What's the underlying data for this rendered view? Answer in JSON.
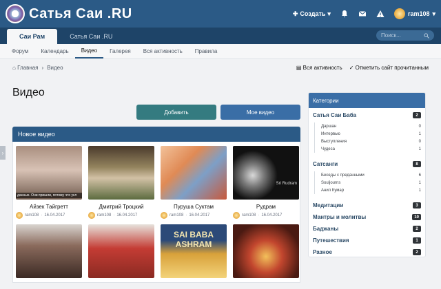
{
  "header": {
    "logo_text": "Сатья Саи .RU",
    "create_label": "Создать",
    "username": "ram108"
  },
  "nav": {
    "tabs": [
      "Саи Рам",
      "Сатья Саи .RU"
    ],
    "search_placeholder": "Поиск...",
    "subtabs": [
      "Форум",
      "Календарь",
      "Видео",
      "Галерея",
      "Вся активность",
      "Правила"
    ]
  },
  "breadcrumb": {
    "home": "Главная",
    "sep": "›",
    "current": "Видео",
    "all_activity": "Вся активность",
    "mark_read": "Отметить сайт прочитанным"
  },
  "page": {
    "title": "Видео",
    "add_button": "Добавить",
    "my_videos_button": "Мое видео",
    "panel_title": "Новое видео"
  },
  "videos": [
    {
      "title": "Айзек Тайгретт",
      "user": "ram108",
      "date": "16.04.2017",
      "thumb_color": "#8b6e5c"
    },
    {
      "title": "Дмитрий Троцкий",
      "user": "ram108",
      "date": "16.04.2017",
      "thumb_color": "#6f7751"
    },
    {
      "title": "Пуруша Суктам",
      "user": "ram108",
      "date": "16.04.2017",
      "thumb_color": "#d87a4a"
    },
    {
      "title": "Рудрам",
      "user": "ram108",
      "date": "16.04.2017",
      "thumb_color": "#1c1c1c"
    },
    {
      "title": "",
      "user": "",
      "date": "",
      "thumb_color": "#70574a"
    },
    {
      "title": "",
      "user": "",
      "date": "",
      "thumb_color": "#a9423a"
    },
    {
      "title": "",
      "user": "",
      "date": "",
      "thumb_color": "#caa13c"
    },
    {
      "title": "",
      "user": "",
      "date": "",
      "thumb_color": "#7a2f1e"
    }
  ],
  "thumb_overlays": {
    "video1": "данных. Они пришли, потому что усл",
    "video3": "Sri Rudram",
    "video7": "SAI BABA ASHRAM"
  },
  "meta_sep": "·",
  "sidebar": {
    "title": "Категории",
    "categories": [
      {
        "name": "Сатья Саи Баба",
        "count": "2",
        "subs": [
          {
            "name": "Даршан",
            "count": "0"
          },
          {
            "name": "Интервью",
            "count": "1"
          },
          {
            "name": "Выступления",
            "count": "0"
          },
          {
            "name": "Чудеса",
            "count": "1"
          }
        ]
      },
      {
        "name": "Сатсанги",
        "count": "8",
        "subs": [
          {
            "name": "Беседы с преданными",
            "count": "6"
          },
          {
            "name": "Souljourns",
            "count": "1"
          },
          {
            "name": "Анил Кумар",
            "count": "1"
          }
        ]
      },
      {
        "name": "Медитации",
        "count": "3",
        "subs": []
      },
      {
        "name": "Мантры и молитвы",
        "count": "10",
        "subs": []
      },
      {
        "name": "Баджаны",
        "count": "2",
        "subs": []
      },
      {
        "name": "Путешествия",
        "count": "1",
        "subs": []
      },
      {
        "name": "Разное",
        "count": "2",
        "subs": []
      }
    ]
  }
}
